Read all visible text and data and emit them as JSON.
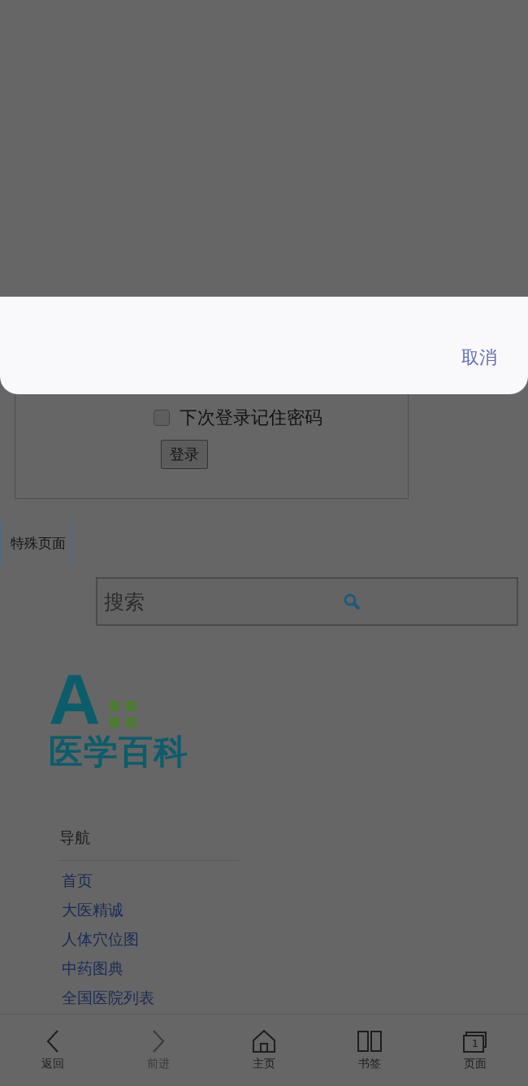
{
  "dialog": {
    "cancel": "取消"
  },
  "login": {
    "remember_label": "下次登录记住密码",
    "remember_checked": false,
    "submit": "登录"
  },
  "special_tab": "特殊页面",
  "search": {
    "placeholder": "搜索"
  },
  "logo": {
    "letter": "A",
    "name": "医学百科"
  },
  "navigation": {
    "heading": "导航",
    "links": [
      "首页",
      "大医精诚",
      "人体穴位图",
      "中药图典",
      "全国医院列表"
    ]
  },
  "toolbar": [
    {
      "kind": "back",
      "label": "返回",
      "disabled": false
    },
    {
      "kind": "forward",
      "label": "前进",
      "disabled": true
    },
    {
      "kind": "home",
      "label": "主页",
      "disabled": false
    },
    {
      "kind": "bookmarks",
      "label": "书签",
      "disabled": false
    },
    {
      "kind": "pages",
      "label": "页面",
      "disabled": false,
      "count": "1"
    }
  ]
}
